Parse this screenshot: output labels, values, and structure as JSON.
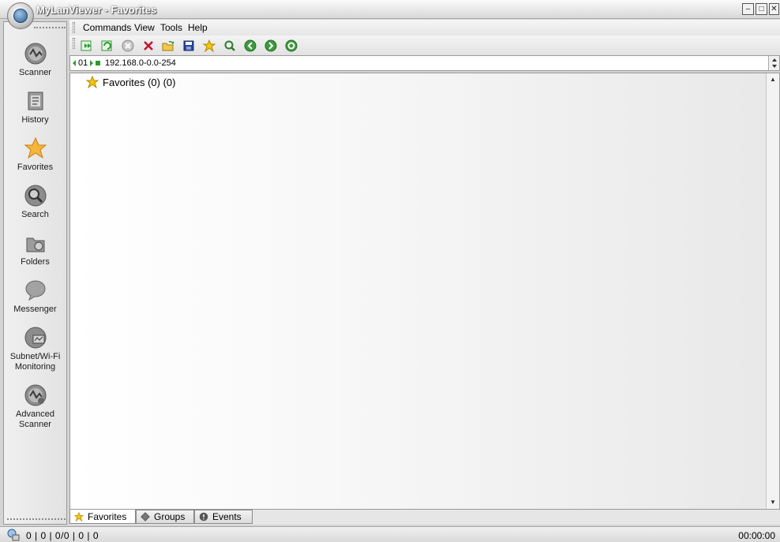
{
  "window": {
    "title": "MyLanViewer - Favorites",
    "buttons": {
      "minimize": "–",
      "maximize": "□",
      "close": "✕"
    }
  },
  "nav": {
    "items": [
      {
        "label": "Scanner",
        "icon": "scanner-icon"
      },
      {
        "label": "History",
        "icon": "history-icon"
      },
      {
        "label": "Favorites",
        "icon": "favorites-star-icon"
      },
      {
        "label": "Search",
        "icon": "search-icon"
      },
      {
        "label": "Folders",
        "icon": "folders-icon"
      },
      {
        "label": "Messenger",
        "icon": "messenger-icon"
      },
      {
        "label_line1": "Subnet/Wi-Fi",
        "label_line2": "Monitoring",
        "icon": "subnet-monitoring-icon"
      },
      {
        "label_line1": "Advanced",
        "label_line2": "Scanner",
        "icon": "advanced-scanner-icon"
      }
    ]
  },
  "menu": {
    "commands": "Commands",
    "view": "View",
    "tools": "Tools",
    "help": "Help"
  },
  "toolbar": {
    "icons": [
      "scan-icon",
      "rescan-icon",
      "stop-icon",
      "delete-icon",
      "open-folder-icon",
      "save-icon",
      "add-favorite-icon",
      "find-icon",
      "back-icon",
      "forward-icon",
      "refresh-icon"
    ]
  },
  "address": {
    "prefix": "01",
    "value": "192.168.0-0.0-254"
  },
  "tree": {
    "favorites_node": "Favorites (0) (0)"
  },
  "tabs": {
    "favorites": "Favorites",
    "groups": "Groups",
    "events": "Events"
  },
  "status": {
    "counts": "0 | 0 | 0/0 | 0 | 0",
    "time": "00:00:00"
  },
  "colors": {
    "star": "#f5c60e",
    "green_ok": "#2e9a2e",
    "red_delete": "#c8102e",
    "save_blue": "#27449a"
  }
}
